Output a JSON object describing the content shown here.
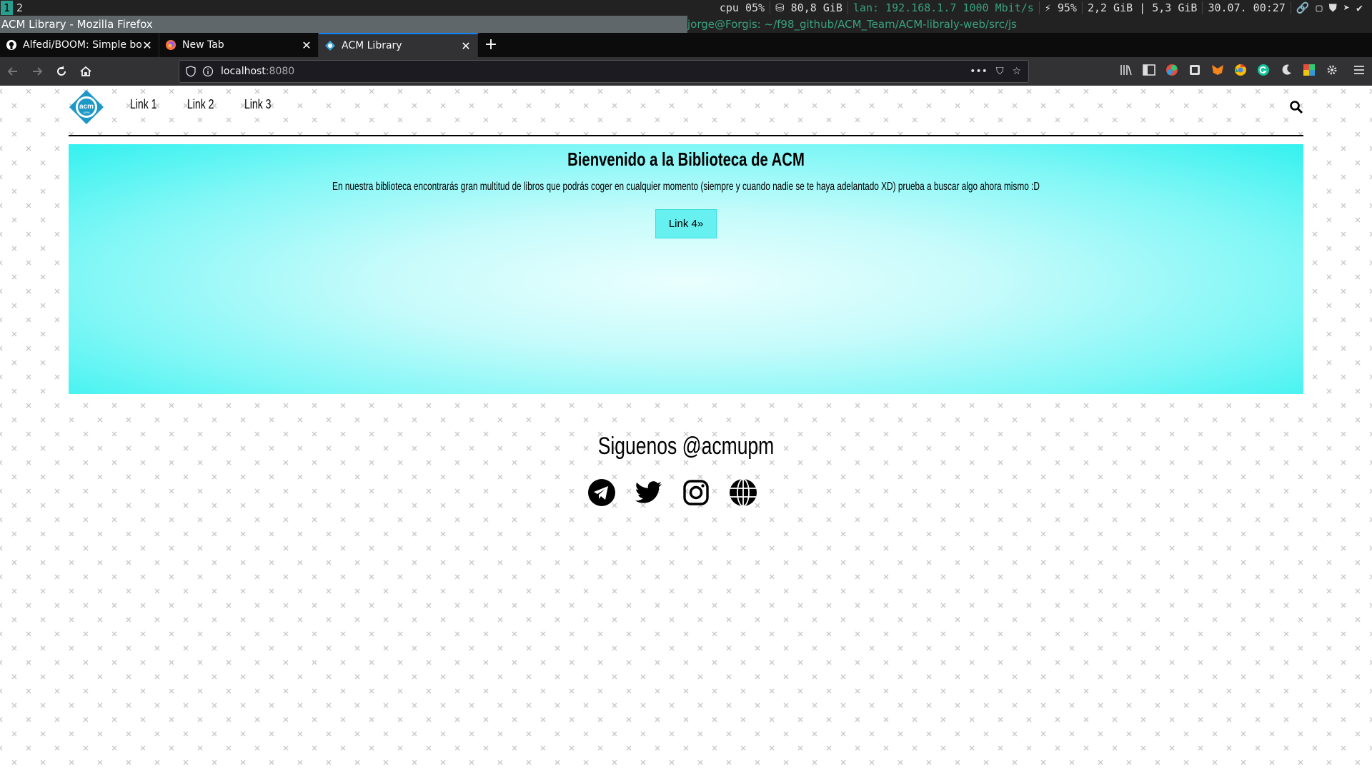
{
  "statusbar": {
    "workspaces": [
      "1",
      "2"
    ],
    "cpu": "cpu  05%",
    "disk": "⛁ 80,8 GiB",
    "lan": "lan: 192.168.1.7 1000 Mbit/s",
    "battery": "⚡ 95%",
    "memory": "2,2 GiB | 5,3 GiB",
    "datetime": "30.07. 00:27"
  },
  "windows": {
    "left_title": "ACM Library - Mozilla Firefox",
    "right_title": "jorge@Forgis: ~/f98_github/ACM_Team/ACM-libraly-web/src/js"
  },
  "tabs": [
    {
      "label": "Alfedi/BOOM: Simple boo",
      "icon": "github-icon"
    },
    {
      "label": "New Tab",
      "icon": "firefox-icon"
    },
    {
      "label": "ACM Library",
      "icon": "acm-icon"
    }
  ],
  "urlbar": {
    "host": "localhost",
    "port": ":8080"
  },
  "site": {
    "nav": [
      "Link 1",
      "Link 2",
      "Link 3"
    ],
    "hero_title": "Bienvenido a la Biblioteca de ACM",
    "hero_text": "En nuestra biblioteca encontrarás gran multitud de libros que podrás coger en cualquier momento (siempre y cuando nadie se te haya adelantado XD) prueba a buscar algo ahora mismo :D",
    "hero_button": "Link 4»",
    "follow_title": "Siguenos @acmupm",
    "socials": [
      "telegram-icon",
      "twitter-icon",
      "instagram-icon",
      "globe-icon"
    ]
  },
  "colors": {
    "hero_edge": "#33f1ef",
    "hero_center": "#eafffe",
    "button_bg": "#66f1f0",
    "accent": "#0a84ff"
  }
}
